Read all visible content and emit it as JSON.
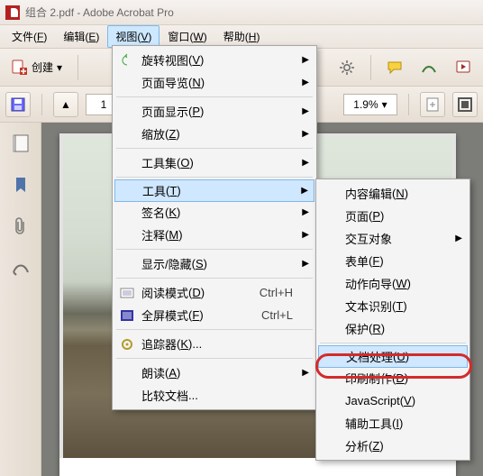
{
  "window": {
    "title": "组合 2.pdf - Adobe Acrobat Pro"
  },
  "menubar": {
    "file": {
      "label": "文件",
      "m": "F"
    },
    "edit": {
      "label": "编辑",
      "m": "E"
    },
    "view": {
      "label": "视图",
      "m": "V"
    },
    "window": {
      "label": "窗口",
      "m": "W"
    },
    "help": {
      "label": "帮助",
      "m": "H"
    }
  },
  "toolbar": {
    "create_label": "创建",
    "page_number": "1",
    "zoom_value": "1.9%"
  },
  "view_menu": {
    "rotate": {
      "label": "旋转视图",
      "m": "V"
    },
    "nav": {
      "label": "页面导览",
      "m": "N"
    },
    "disp": {
      "label": "页面显示",
      "m": "P"
    },
    "zoom": {
      "label": "缩放",
      "m": "Z"
    },
    "toolset": {
      "label": "工具集",
      "m": "O"
    },
    "tools": {
      "label": "工具",
      "m": "T"
    },
    "sign": {
      "label": "签名",
      "m": "K"
    },
    "comment": {
      "label": "注释",
      "m": "M"
    },
    "showhide": {
      "label": "显示/隐藏",
      "m": "S"
    },
    "readmode": {
      "label": "阅读模式",
      "m": "D",
      "shortcut": "Ctrl+H"
    },
    "fullscreen": {
      "label": "全屏模式",
      "m": "F",
      "shortcut": "Ctrl+L"
    },
    "tracker": {
      "label": "追踪器",
      "m": "K",
      "ellipsis": "..."
    },
    "readaloud": {
      "label": "朗读",
      "m": "A"
    },
    "compare": {
      "label": "比较文档",
      "m": "",
      "ellipsis": "..."
    }
  },
  "tools_submenu": {
    "content_edit": {
      "label": "内容编辑",
      "m": "N"
    },
    "pages": {
      "label": "页面",
      "m": "P"
    },
    "interactive": {
      "label": "交互对象",
      "m": ""
    },
    "forms": {
      "label": "表单",
      "m": "F"
    },
    "action_wizard": {
      "label": "动作向导",
      "m": "W"
    },
    "text_recog": {
      "label": "文本识别",
      "m": "T"
    },
    "protect": {
      "label": "保护",
      "m": "R"
    },
    "doc_process": {
      "label": "文档处理",
      "m": "U"
    },
    "print_prod": {
      "label": "印刷制作",
      "m": "D"
    },
    "javascript": {
      "label": "JavaScript",
      "m": "V"
    },
    "accessibility": {
      "label": "辅助工具",
      "m": "I"
    },
    "analyze": {
      "label": "分析",
      "m": "Z"
    }
  }
}
